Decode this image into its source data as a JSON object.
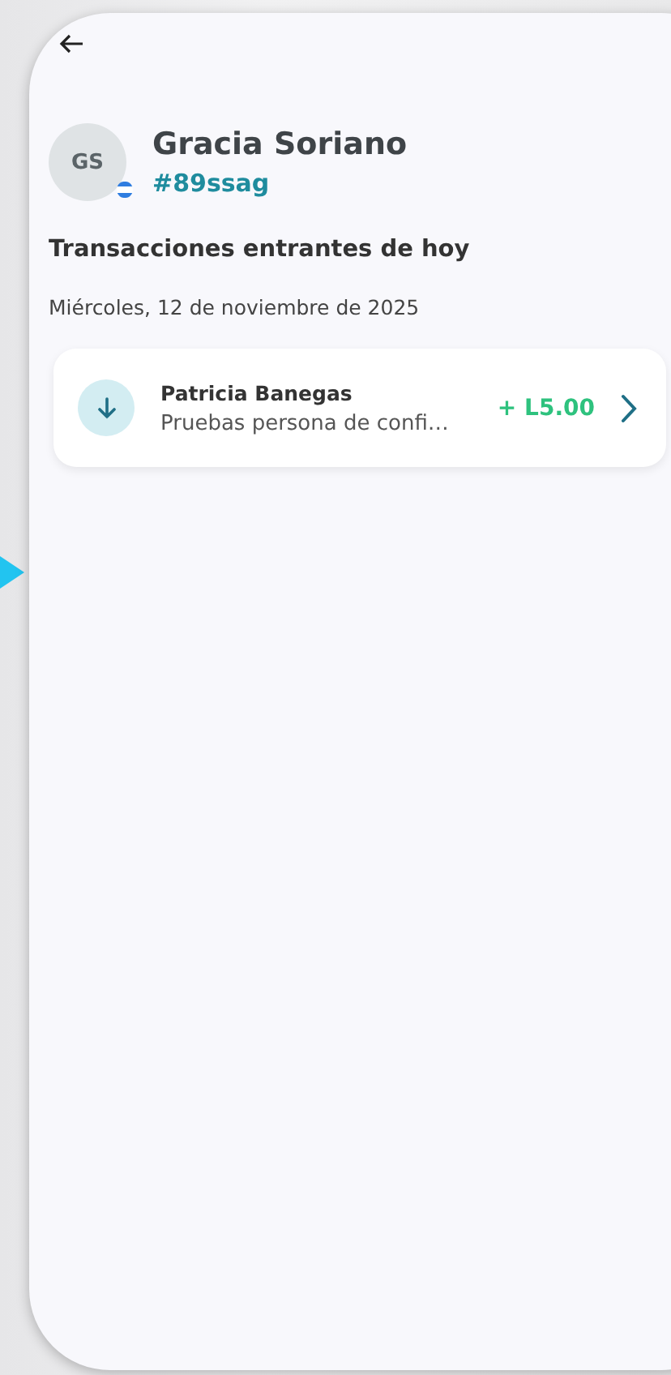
{
  "profile": {
    "initials": "GS",
    "name": "Gracia Soriano",
    "handle": "#89ssag"
  },
  "section_title": "Transacciones entrantes de hoy",
  "date": "Miércoles, 12 de noviembre de 2025",
  "transactions": [
    {
      "kind": "incoming",
      "name": "Patricia Banegas",
      "description": "Pruebas persona de confi…",
      "amount": "+ L5.00"
    }
  ]
}
